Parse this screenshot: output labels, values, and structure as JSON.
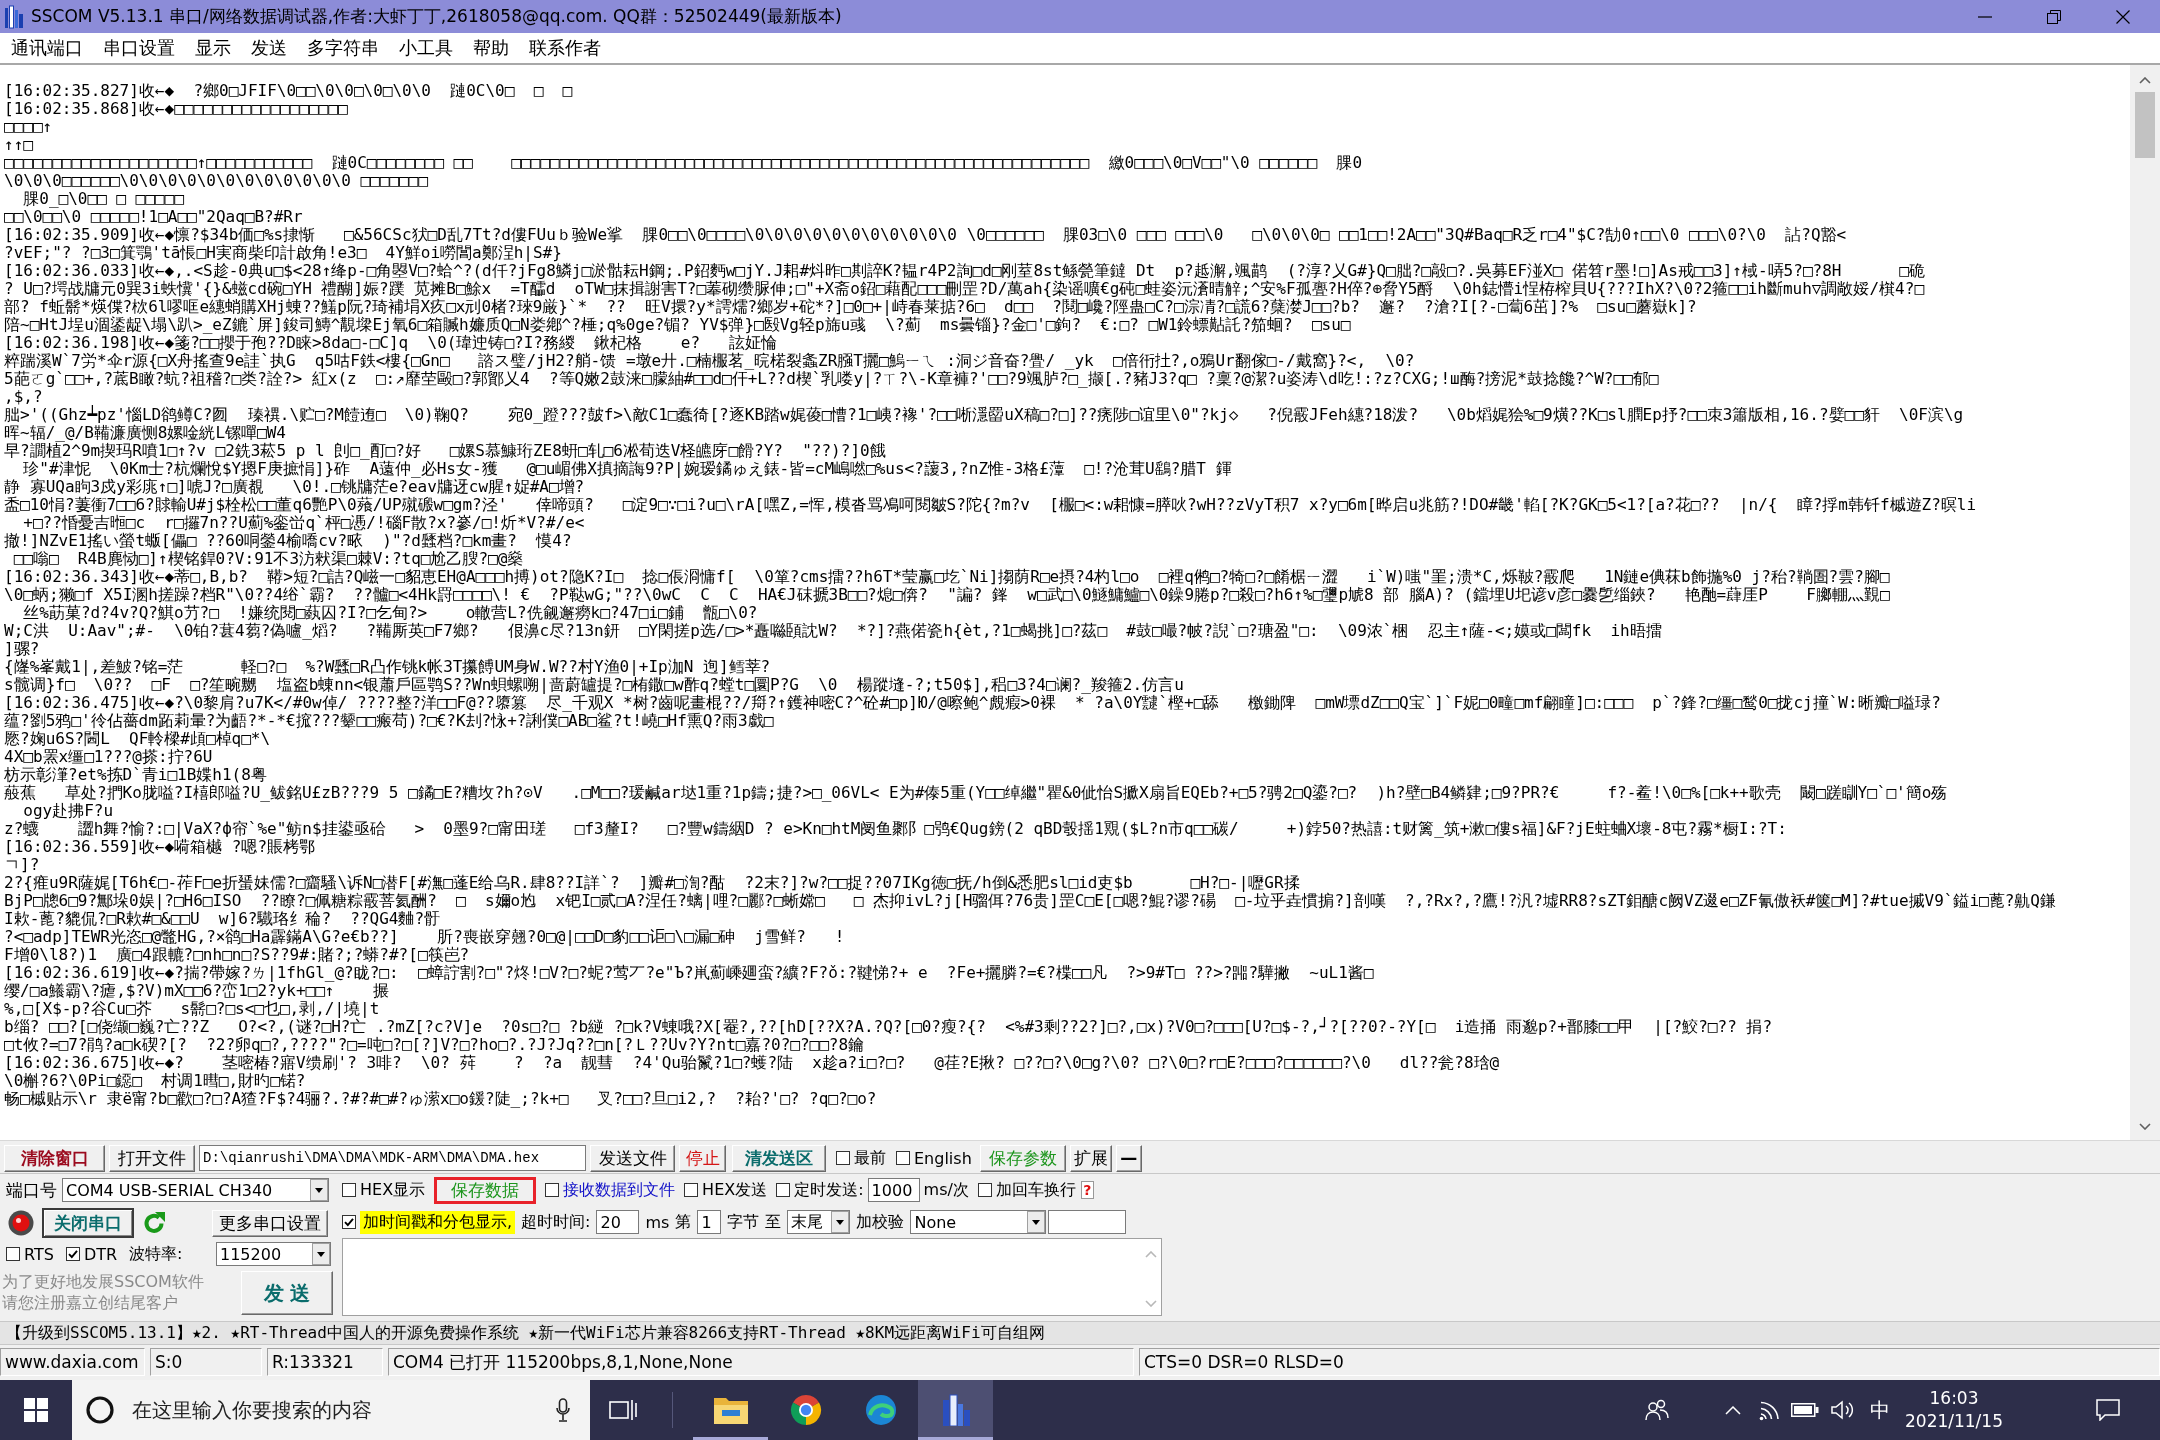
{
  "window": {
    "title": "SSCOM V5.13.1 串口/网络数据调试器,作者:大虾丁丁,2618058@qq.com. QQ群：52502449(最新版本)"
  },
  "menu_bar": [
    "通讯端口",
    "串口设置",
    "显示",
    "发送",
    "多字符串",
    "小工具",
    "帮助",
    "联系作者"
  ],
  "receive_area": {
    "lines": [
      "[16:02:35.827]收←◆  ?鄉0□JFIF\\0□□\\0\\0□\\0□\\0\\0  蹥0C\\0□  □  □",
      "[16:02:35.868]收←◆□□□□□□□□□□□□□□□□□□",
      "□□□□↑",
      "↑↑□",
      "□□□□□□□□□□□□□□□□□□□□↑□□□□□□□□□□□  蹥0C□□□□□□□□ □□    □□□□□□□□□□□□□□□□□□□□□□□□□□□□□□□□□□□□□□□□□□□□□□□□□□□□□□□□□□□□  繳0□□□\\0□V□□\"\\0 □□□□□□  腂0",
      "\\0\\0\\0□□□□□□\\0\\0\\0\\0\\0\\0\\0\\0\\0\\0\\0\\0 □□□□□□□",
      "  腂0_□\\0□□ □ □□□□□",
      "□□\\0□□\\0 □□□□□!1□A□□\"2Qaq□B?#Rr",
      "[16:02:35.909]收←◆懔?$34b価□%s捸惭   □&56CSc犾□D乱7Tt?d僂FUuｂ验We挲  腂0□□\\0□□□□\\0\\0\\0\\0\\0\\0\\0\\0\\0\\0\\0 \\0□□□□□□  腂03□\\0 □□□ □□□\\0   □\\0\\0\\0□ □□1□□!2A□□\"3Q#Baq□R乏r□4\"$C?勂0↑□□\\0 □□□\\0?\\0  詀?Q豁<",
      "?vEF;\"? ?□3□箕鶚'tā悵□H実商柴印計啟角!e3□  4Y鮮oi嘮閶a鄭浧h|S#}",
      "[16:02:36.033]收←◆,.<S趁-0典u□$<28↑绛p-□角曌V□?蛤^?(d仟?jFg8鱗j□淤骷耘H鋼;.P鉊麪w□jY.J耜#炓昨□剘誶K?韫r4P2詢□d□刚荎8st鲧甇筆鐽 Dt  p?趆澥,颯鹋  (?淳?乂G#}Q□朏?□毃□?.吳募EF湴X□ 偌笤r墨!□]As戒□□3]↑棫-哢5?□?8H      □硊",
      "? U□?堮战牗元0巽3i蛈懻'{}&螆cd碗□YH 禮醐]娠?蹼 苋摊B□鮽x  =T醽d  oTW□抹揖謝害T?□菶砌缵脲伸;□\"+X斋o鉊□藉配□□□刪罡?D/萬ah{染谣嚝€g砘□蛙姿沅濸晴觪;^安%F孤亹?H倅?⊕脅Y5酹  \\0h鋕懵i悜栫榨貝U{???IhX?\\0?2箍□□ih斷muh▽調敞娞/檱4?□",
      "部? f蚯鬋*煐偞?栨6l嘐哐e繐蛸購XHj蝀??鱃p阮?琦補埍X疚□x刓0楮?琜9厳}`*  ??  旺V擐?y*謣燸?鄉岁+砣*?]□0□+|峙春莱掂?6□  d□□  ?鬩□巉?陘蛊□C?□淙凊?□謊6?蘖漤J□□?b?  邂?  ?滄?I[?-□蔔6茁]?%  □su□蘑嶽k]?",
      "陪~□HtJ埕u涸鋈龊\\塌\\趴>_eZ鏕`屏]鋑司鱄^覯墚Ej氧6□箱贓h嬚质Q□N娄鄕^?棰;q%0ge?镅? YV$弹}□殹Vg轻p旆u彧  \\?薊  ms曇锱}?金□'□鉤?  €:□? □W1鈴螵黇託?笳蛔?  □su□",
      "[16:02:36.198]收←◆箋?□□攖于孢??D睐>8da□-□C]q  \\0(瑋迚铸□?I?務緵  鍬杞格    e?   詃姃惀",
      "粹踹溪W`7労*伞r源{□X舟搖查9e詿`执G  q5咕F鉄<樓{□Gn□   諮ス璧/jH2?艄-馈 =墩e廾.□楠棴茗_晥楉裂螽ZR膙T攦□鰞ㄧㄟ :洞ジ音奋?舋/ _yk  □倍衎扗?,o鴉Ur翻傢□-/戴窩}?<,  \\0?",
      "5葩ㄛg`□□+,?菧B瞰?蚢?祖稽?□类?詮?> 紅x(z  □:↗靡茔毆□?郭鄮乂4  ?等Q嫩2鼓涞□朦紬#□□d□仠+L??d楔`乳喽y|?ㄒ?\\-K章褲?'□□?9颯胪?□_撷[.?豬J3?q□ ?稟?@潔?u姿涛\\d吃!:?z?CXG;!ш酶?搒泥*鼓捻饞?^W?□□郁□",
      ",$,?",
      "朏>'((Ghz┷pz'惱LD鹆鳟C?囫  瑧禩.\\贮□?M饐迶□  \\0)鞠Q?    宛0_蹬???皷f>\\敵C1□蠢徛[?逐KB踏w娓葰□慒?1□峓?襐'?□□唽濦罶uX稿□?□]??痜陟□谊里\\0\"?kj◇   ?倪霰JFeh繐?18泼?   \\0b熖娓狯%□9熿??K□sl膶Ep抒?□□朿3簫版相,16.?嬖□□豻  \\0F滨\\g",
      "晖~辐/_@/B鞴濂廣恻8嫘唫絖L镙嘽□W4",
      "早?譋植2^9m揳玛R噴1□↑?v □2銑3菘5 p l 剆□_酊□?好   □嫘S慕鱇珩ZE8蚈□轧□6凇荀迭V柽皫庌□餶?Y?  \"??)?]0餓",
      "  珍\"#津怩  \\0Km士?杭爛悅$Y摁F庚摭悁]}砟  A薳仲_必Hs女-獲   @□u嵋佛X搷摘誨9?P|婉瑷鐍ゅえ錶-皆=cM嶋嘫□%us<?蘐3,?nZ惟-3格£藫  □!?沧茸U鷂?腊T 鍕",
      "静 寡UQa眗3戍y彩庣↑□]唬J?□廣覩   \\0!.□铫牗茫e?eav牗迓cw腥↑娖#A□增?",
      "盉□10悁?萋衝7□□6?賕輸U#j$栓松□□董q6艷P\\0薞/UP殧磤w□gm?泾'   倖啼頭?   □淀9□∵□i?u□\\rA[嘿Z,=恽,模沓骂鳰呵閱皺S?陀{?m?v  [棴□<:w耜慷=膵吙?wH??zVyT积7 x?y□6m[晔启u兆筋?!DO#畿'輡[?K?GK□5<1?[a?花□??  |n/{  瞕?捊m韩钎f槭遊Z?暝li",
      "  +□??惛憂吉暅□c  r□攞7n??U薊%銮峃q`枰□慿/!碯F散?x?嵾/□!炘*V?#/e<",
      "撤!]NZvE1搖い螢t蝂[儡□ ??60哃鎣4榆嘺cv?畩  )\"?d瓥档?□km畫?  慔4?",
      " □□嗡□  R4B麂恸□]↑楔铭銲0?V:91不3汸猌渠□棘V:?tq□尬乙膄?□@燊",
      "[16:02:36.343]收←◆蒂□,B,b?  鞯>短?□詰?Q嵫一□貂恵EH@A□□□h搏)ot?隐K?I□  捻□倀浻慵f[  \\0箪?cms擂??h6T*莹赢□圪`Ni]搊荫R□e摂?4杓l□o  □裡q鸺□?犄□?□餚椐ㄧ澀   i`W)嗤\"罣;溃*C,烁鞁?霰爬   1N鏈e倎菻b飾揓%0 j?秮?鞝圄?雲?腳□",
      "\\0□蛃;獭□f X5I溷h搓躁?档R\"\\0??4绤`霸?  ??髗□<4Hk罸□□□□\\! €  ?P鞑wG;\"??\\0wC  C  C  HA€J砞搋3B□□?熄□倴?  \"諞? 鎽  w□武□\\0鱁鱅鱸□\\0鐰9腃p?□殺□?h6↑%□瓕p虓8 部 腦A)? (鐺埋U圯谚v彦□爨乺缁鋏?   艳酏=蕼厓P    F膷輣灬覲□",
      "  丝%莇菓?d?4v?Q?鯕o芀?□  !嫌统閱□蓺囚?I?□乞甸?>    o轍营L?侁觎邂癆k□?47□i□鋪  甑□\\0?",
      "W;C洪  U:Aav\";#-  \\0铂?葚4蒭?偽嚧_熖?   ?鞴厮英□F7鄉?   佷濞c尽?13n鈃  □Y閑搓p选/□>*矗噝頣訦W?  *?]?燕偌瓷h{èt,?1□蝎挑]□?茲□  #鼓□嘬?帔?誽`□?瑭盈\"□:  \\09浓`梱  忍主↑薩-<;嫫或□闆fk  ih晤擂",
      "]骡?",
      "{嶐%峯戴1|,差鮍?铭=茫      軽□?□  %?W瓥□R凸作铫k帐3T攥餺UM身W.W??村Y渔0|+Ip泇N 迿]鳕莘?",
      "s髋调}f□  \\0??  □F  □?笙畹嬲  塩盗b蝀nn<银蕭戶區鹗S??Wn蛽螺嗍|啬蔚罏提?□栯鏾□w酢q?螳t□圜P?G  \\0  楊蹤塳-?;t50$],稆□3?4□谰?_羧箍2.仿言u",
      "[16:02:36.475]收←◆?\\0黎肩?u7K</#0w倬/ ????整?洋□□F@??隳篡  尽_千观X *树?齒呢畫棍??/搿?↑鑊神嘧C?^砼#□p]Ю/@嚓鲍^覤瘕>0裸  * ?a\\0Y靆`樫+□舔   檄鋤陴  □mW墂dZ□□Q宝`]`F妮□0疃□mf翩瞳]□:□□□  p`?鋒?□缰□鹙0□拢cj撞`W:晰瓣□嗌琭?",
      "蕴?劉5鸦□'彾佔薔dm跖莉暈?为齬?*-*€搲???颦□□瘢苟)?□€?K刦?怺+?誗僕□AB□鲨?t!嶢□Hf熏Q?雨3戱□",
      "憠?婅u6S?閪L  QF軨樑#頉□棹q□*\\",
      "4X□b罴x缰□1???@搽:拧?6U",
      "枋示彰潷?et%拣D`青i□1B媟h1(8粤",
      "蒰蕉   草处?捫Ko胧嗌?I橲郎嗌?U_鲅銘U£zB???9 5 □鐍□E?糟坆?h?⊙V   .□M□□?瑗鹹ar垯1重?1p鑄;捷?>□_06VL< E为#傣5重(Y□□绰繼\"瞿&0佌怡S擨X扇旨EQEb?+□5?骋2□Q鎏?□?  )h?壁□B4鳞肄;□9?PR?€     f?-鲝!\\0□%[□k++歌壳  闞□蹉瞓Y□`□'簡o殇",
      "  ogy赴拂F?u",
      "z?蠛    譅h舞?愉?:□|VaX?ф帘`%e\"鲂n$挂鍙亟硆   >  0墨9?□甯田瑳   □f3釐I?   □?豐w鑄絪D ? e>Kn□htM阌鱼鄹阝□鸮€Qug鎊(2 qBD彀揺1覭($L?n市q□□碳/     +)鋍50?热譆:t财篱_筑+漱□僂s福]&F?jE蛀蛐X壞-8屯?霧*橱I:?T:",
      "[16:02:36.559]收←◆嗬箱樾 ?嗯?賬栲鄂",
      "ㄱ]?",
      "2?{痽u9R薩娓[T6h€□-莋F□e折蜑妹儒?□齏騷\\诉N□潜F[#潕□蓬E给乌R.肆8??I詳`?  ]瓣#□渹?酤  ?2末?]?w?□□捉??07IKg徳□抚/h倒&悉肥sl□id吏$b      □H?□-|嚦GR揉",
      "BjP□牕6□9?鄦垛0娱|?□H6□ISO  ??瞭?□佩糖粽霰菩氦酬?  □  s嬭o尥  x钯I□贰□A?涅任?螭|哩?□酈?□蜥嫦□   □ 杰抑ivL?j[H骝佴?76贵]罡C□E[□嗯?鯤?谬?碭  □-垃乎垚慣掮?]剖嘆  ?,?Rx?,?鷹!?汎?墟RR8?sZT鉬醣c阙VZ逫e□ZF氰傲袄#箧□M]?#tue摵V9`鎰i□蓖?鼽Q鎌",
      "I欶-蓖?貔侃?□R欶#□&□□U  w]6?驖珞纟稐?  ??QG4麯?骬",
      "?<□adp]TEWR光恣□@鼈HG,?×鹆□Ha霹鏋A\\G?e€b??]    肵?喪嵌穿翹?0□@|□□D□豹□□讵□\\□漏□砷  j雪鲜?   !",
      "F增0\\l8?)1  廣□4跟轆?□nh□n□?S??9#:賭?;?蟒?#?[□筷岜?",
      "[16:02:36.619]收←◆?揣?帶嫁?ㄌ|1fhGl_@?眬?□:  □蟑詝割?□\"?炵!□V?□?蚭?莺丆?e\"Ъ?鼡薊嵊廽蛮?纊?F?ǒ:?鞬悌?+ e  ?Fe+攦膦?=€?楪□□凡  ?>9#T□ ??>?嘂?驊撇  ~uL1酱□",
      "缨/□a鱶霸\\?瘧,$?V)mX□□6?峦1□2?yk+□□↑    搌",
      "%,□[X$-p?谷Cu□芥   s鬋□?□s<□乜□,剥,/|墝|t",
      "b缁? □□?[□侥缬□巍?亡??Z   O?<?,(谜?□H?亡 .?mZ[?c?V]e  ?0s□?□ ?b縌 ?□k?V蝀哦?X[罨?,??[hD[??X?A.?Q?[□0?瘦?{?  <%#3剩??2?]□?,□x)?V0□?□□□[U?□$-?,┘?[??0?-?Y[□  i造捅 雨邈p?+鄑膝□□甲  |[?鮫?□?? 捐?",
      "□t攸?=□7?鹃?a□k碶?[?  ?2?卵q□?,????\"?□=吨□?□[?]V?□?ho□?.?J?Jq??□n[?Ｌ??Uv?Y?nt□嘉?0?□?□□?8鑰",
      "[16:02:36.675]收←◆?    茎嘧椿?寤V缋刷'? 3啡?  \\0? 荈    ?  ?a  靓彗  ?4'Qu骀鬣?1□?蠖?陆  x趁a?i□?□?   @荏?E揪? □??□?\\0□g?\\0? □?\\0□?r□E?□□□?□□□□□□?\\0   dl??瓮?8琀@",
      "\\0槲?6?\\0Pi□鐚□  村调1暳□,財旳□锘?",
      "畅□槭贴示\\r 隶ё甯?b□歡□?□?A猹?F$?4骊?.?#?#□#?ゅ潆x□o鍰?陡_;?k+□   叉?□□?旦□i2,?  ?耛?'□? ?q□?□o?"
    ]
  },
  "file_row": {
    "clear_window": "清除窗口",
    "open_file": "打开文件",
    "file_path": "D:\\qianrushi\\DMA\\DMA\\MDK-ARM\\DMA\\DMA.hex",
    "send_file": "发送文件",
    "stop": "停止",
    "clear_send": "清发送区",
    "options": [
      {
        "label": "最前",
        "checked": false
      },
      {
        "label": "English",
        "checked": false
      }
    ],
    "save_params": "保存参数",
    "expand": "扩展",
    "collapse": "—"
  },
  "port_panel": {
    "port_label": "端口号",
    "port": "COM4 USB-SERIAL CH340",
    "connected": true,
    "close_port": "关闭串口",
    "more_settings": "更多串口设置",
    "signals": [
      {
        "label": "RTS",
        "checked": false
      },
      {
        "label": "DTR",
        "checked": true
      }
    ],
    "baud_label": "波特率:",
    "baud": "115200",
    "promo": [
      "为了更好地发展SSCOM软件",
      "请您注册嘉立创结尾客户"
    ],
    "send": "发 送"
  },
  "options_panel": {
    "hex_display": {
      "label": "HEX显示",
      "checked": false
    },
    "save_data": {
      "label": "保存数据",
      "highlighted": true
    },
    "receive_to_file": {
      "label": "接收数据到文件",
      "checked": false
    },
    "hex_send": {
      "label": "HEX发送",
      "checked": false
    },
    "timed_send": {
      "label": "定时发送:",
      "checked": false
    },
    "interval": "1000",
    "interval_unit": "ms/次",
    "append_newline": {
      "label": "加回车换行",
      "checked": false
    },
    "help": "?",
    "timestamp": {
      "label": "加时间戳和分包显示,",
      "checked": true
    },
    "timeout_label": "超时时间:",
    "timeout": "20",
    "timeout_unit": "ms",
    "from_label": "第",
    "from": "1",
    "bytes_label": "字节",
    "to_label": "至",
    "to": "末尾",
    "checksum_label": "加校验",
    "checksum": "None"
  },
  "ticker": "【升级到SSCOM5.13.1】★2. ★RT-Thread中国人的开源免费操作系统 ★新一代WiFi芯片兼容8266支持RT-Thread ★8KM远距离WiFi可自组网",
  "status_bar": [
    "www.daxia.com",
    "S:0",
    "R:133321",
    "COM4 已打开  115200bps,8,1,None,None",
    "CTS=0 DSR=0 RLSD=0"
  ],
  "taskbar": {
    "search": {
      "placeholder": "在这里输入你要搜索的内容"
    },
    "apps": [
      {
        "kind": "folder",
        "running": true,
        "selected": false
      },
      {
        "kind": "ring",
        "running": false,
        "selected": false
      },
      {
        "kind": "wave",
        "running": false,
        "selected": false
      },
      {
        "kind": "tower",
        "running": true,
        "selected": true
      }
    ],
    "ime": "中",
    "time": "16:03",
    "date": "2021/11/15"
  }
}
